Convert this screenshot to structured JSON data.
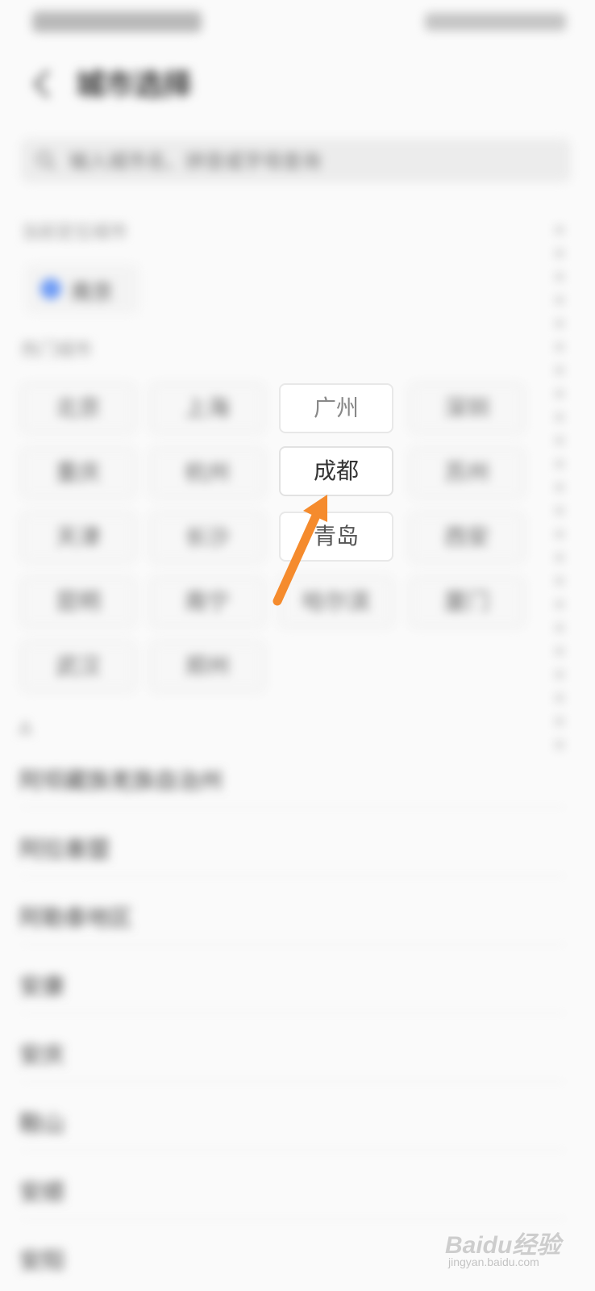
{
  "screen": {
    "title": "城市选择",
    "search": {
      "placeholder": "输入城市名、拼音或字母查询"
    },
    "current_location": {
      "label": "当前定位城市",
      "city": "南京"
    },
    "hot_cities": {
      "label": "热门城市",
      "items": [
        "北京",
        "上海",
        "广州",
        "深圳",
        "重庆",
        "杭州",
        "成都",
        "苏州",
        "天津",
        "长沙",
        "青岛",
        "西安",
        "昆明",
        "南宁",
        "哈尔滨",
        "厦门",
        "武汉",
        "郑州"
      ]
    },
    "list": {
      "section_letter": "A",
      "items": [
        "阿坝藏族羌族自治州",
        "阿拉善盟",
        "阿勒泰地区",
        "安康",
        "安庆",
        "鞍山",
        "安顺",
        "安阳"
      ]
    },
    "annotation": {
      "color": "#f58b2d"
    },
    "watermark": {
      "brand": "Baidu经验",
      "url": "jingyan.baidu.com"
    }
  }
}
